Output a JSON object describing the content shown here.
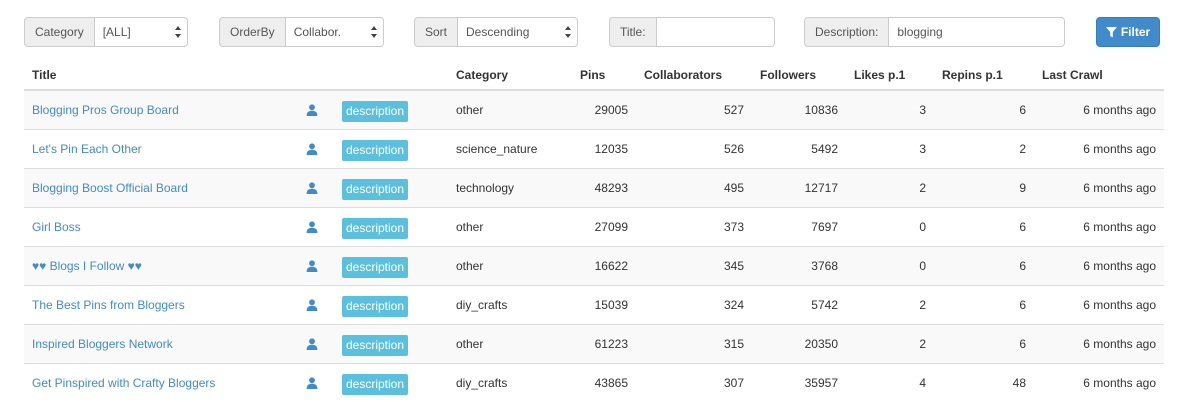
{
  "filters": {
    "category": {
      "label": "Category",
      "value": "[ALL]"
    },
    "orderby": {
      "label": "OrderBy",
      "value": "Collabor."
    },
    "sort": {
      "label": "Sort",
      "value": "Descending"
    },
    "title": {
      "label": "Title:",
      "value": ""
    },
    "description": {
      "label": "Description:",
      "value": "blogging"
    },
    "filter_button": "Filter"
  },
  "table": {
    "headers": [
      "Title",
      "",
      "Category",
      "Pins",
      "Collaborators",
      "Followers",
      "Likes p.1",
      "Repins p.1",
      "Last Crawl"
    ],
    "description_label": "description",
    "rows": [
      {
        "title": "Blogging Pros Group Board",
        "category": "other",
        "pins": "29005",
        "collaborators": "527",
        "followers": "10836",
        "likes": "3",
        "repins": "6",
        "last_crawl": "6 months ago"
      },
      {
        "title": "Let's Pin Each Other",
        "category": "science_nature",
        "pins": "12035",
        "collaborators": "526",
        "followers": "5492",
        "likes": "3",
        "repins": "2",
        "last_crawl": "6 months ago"
      },
      {
        "title": "Blogging Boost Official Board",
        "category": "technology",
        "pins": "48293",
        "collaborators": "495",
        "followers": "12717",
        "likes": "2",
        "repins": "9",
        "last_crawl": "6 months ago"
      },
      {
        "title": "Girl Boss",
        "category": "other",
        "pins": "27099",
        "collaborators": "373",
        "followers": "7697",
        "likes": "0",
        "repins": "6",
        "last_crawl": "6 months ago"
      },
      {
        "title": "♥♥ Blogs I Follow ♥♥",
        "category": "other",
        "pins": "16622",
        "collaborators": "345",
        "followers": "3768",
        "likes": "0",
        "repins": "6",
        "last_crawl": "6 months ago"
      },
      {
        "title": "The Best Pins from Bloggers",
        "category": "diy_crafts",
        "pins": "15039",
        "collaborators": "324",
        "followers": "5742",
        "likes": "2",
        "repins": "6",
        "last_crawl": "6 months ago"
      },
      {
        "title": "Inspired Bloggers Network",
        "category": "other",
        "pins": "61223",
        "collaborators": "315",
        "followers": "20350",
        "likes": "2",
        "repins": "6",
        "last_crawl": "6 months ago"
      },
      {
        "title": "Get Pinspired with Crafty Bloggers",
        "category": "diy_crafts",
        "pins": "43865",
        "collaborators": "307",
        "followers": "35957",
        "likes": "4",
        "repins": "48",
        "last_crawl": "6 months ago"
      }
    ]
  },
  "icons": {
    "user": "user-icon",
    "filter": "filter-icon",
    "select": "select-arrows-icon"
  },
  "colors": {
    "link": "#428bca",
    "label": "#5bc0de",
    "button": "#428bca"
  }
}
